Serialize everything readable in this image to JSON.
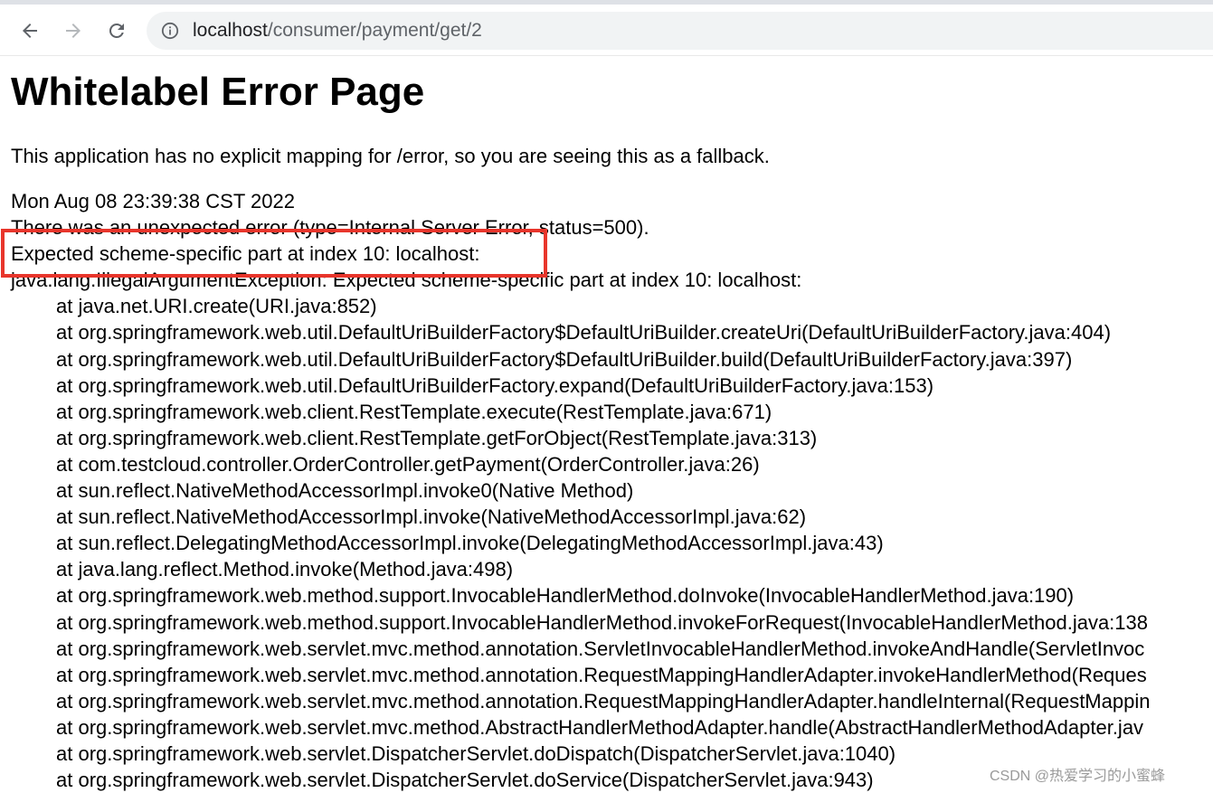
{
  "browser": {
    "url_host": "localhost",
    "url_path": "/consumer/payment/get/2",
    "icons": {
      "back": "back-arrow-icon",
      "forward": "forward-arrow-icon",
      "reload": "reload-icon",
      "info": "info-icon"
    }
  },
  "page": {
    "title": "Whitelabel Error Page",
    "description": "This application has no explicit mapping for /error, so you are seeing this as a fallback.",
    "timestamp": "Mon Aug 08 23:39:38 CST 2022",
    "error_line": "There was an unexpected error (type=Internal Server Error, status=500).",
    "message": "Expected scheme-specific part at index 10: localhost:",
    "exception": "java.lang.IllegalArgumentException: Expected scheme-specific part at index 10: localhost:",
    "stack": [
      "at java.net.URI.create(URI.java:852)",
      "at org.springframework.web.util.DefaultUriBuilderFactory$DefaultUriBuilder.createUri(DefaultUriBuilderFactory.java:404)",
      "at org.springframework.web.util.DefaultUriBuilderFactory$DefaultUriBuilder.build(DefaultUriBuilderFactory.java:397)",
      "at org.springframework.web.util.DefaultUriBuilderFactory.expand(DefaultUriBuilderFactory.java:153)",
      "at org.springframework.web.client.RestTemplate.execute(RestTemplate.java:671)",
      "at org.springframework.web.client.RestTemplate.getForObject(RestTemplate.java:313)",
      "at com.testcloud.controller.OrderController.getPayment(OrderController.java:26)",
      "at sun.reflect.NativeMethodAccessorImpl.invoke0(Native Method)",
      "at sun.reflect.NativeMethodAccessorImpl.invoke(NativeMethodAccessorImpl.java:62)",
      "at sun.reflect.DelegatingMethodAccessorImpl.invoke(DelegatingMethodAccessorImpl.java:43)",
      "at java.lang.reflect.Method.invoke(Method.java:498)",
      "at org.springframework.web.method.support.InvocableHandlerMethod.doInvoke(InvocableHandlerMethod.java:190)",
      "at org.springframework.web.method.support.InvocableHandlerMethod.invokeForRequest(InvocableHandlerMethod.java:138",
      "at org.springframework.web.servlet.mvc.method.annotation.ServletInvocableHandlerMethod.invokeAndHandle(ServletInvoc",
      "at org.springframework.web.servlet.mvc.method.annotation.RequestMappingHandlerAdapter.invokeHandlerMethod(Reques",
      "at org.springframework.web.servlet.mvc.method.annotation.RequestMappingHandlerAdapter.handleInternal(RequestMappin",
      "at org.springframework.web.servlet.mvc.method.AbstractHandlerMethodAdapter.handle(AbstractHandlerMethodAdapter.jav",
      "at org.springframework.web.servlet.DispatcherServlet.doDispatch(DispatcherServlet.java:1040)",
      "at org.springframework.web.servlet.DispatcherServlet.doService(DispatcherServlet.java:943)"
    ]
  },
  "annotation": {
    "highlight_color": "#e8352b"
  },
  "watermark": "CSDN @热爱学习的小蜜蜂"
}
